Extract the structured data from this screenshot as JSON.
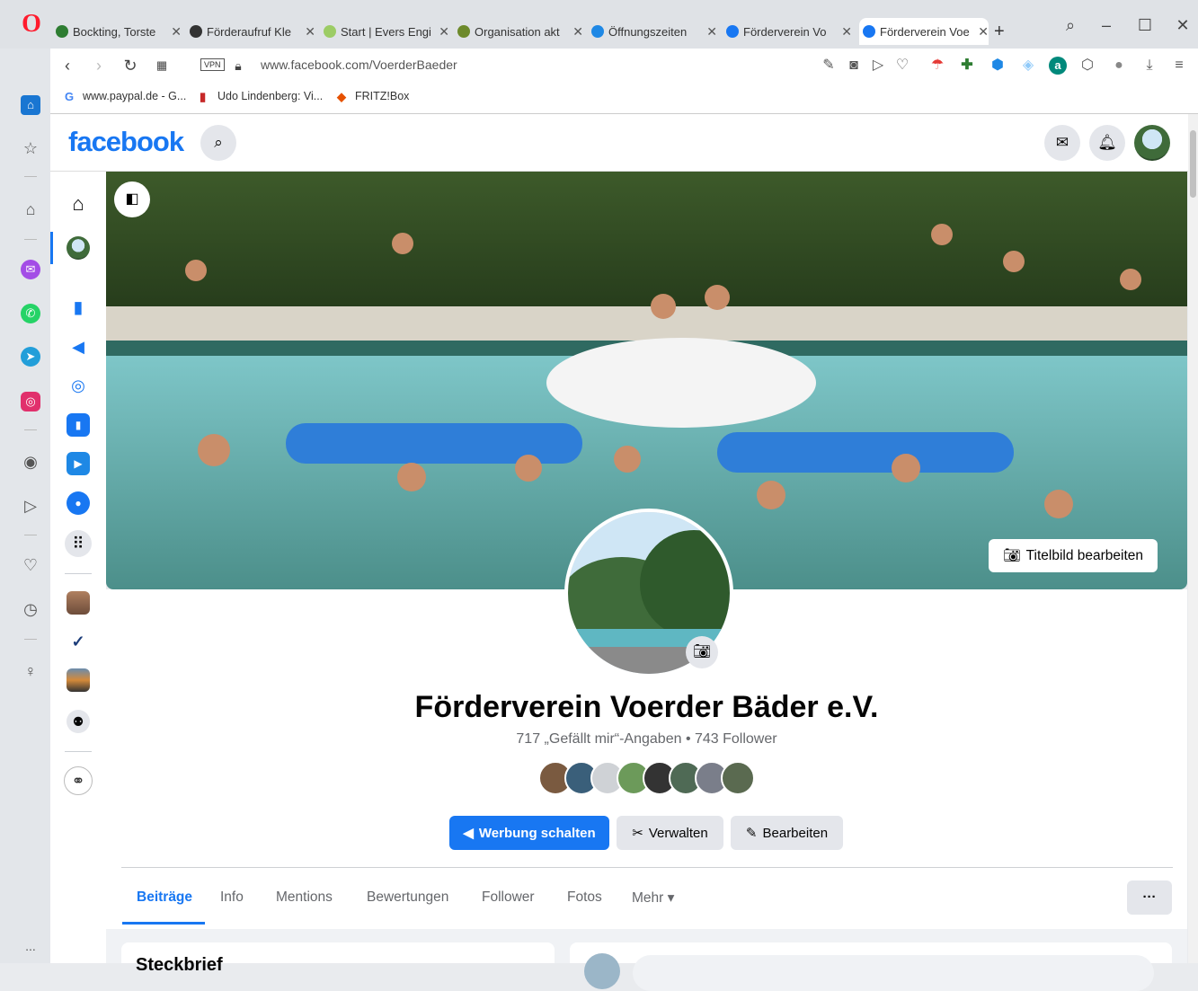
{
  "browser": {
    "tabs": [
      {
        "title": "Bockting, Torste",
        "favicon_color": "#2e7d32"
      },
      {
        "title": "Förderaufruf Kle",
        "favicon_color": "#333333"
      },
      {
        "title": "Start | Evers Engi",
        "favicon_color": "#9ccc65"
      },
      {
        "title": "Organisation akt",
        "favicon_color": "#6d8a2b"
      },
      {
        "title": "Öffnungszeiten",
        "favicon_color": "#1e88e5"
      },
      {
        "title": "Förderverein Vo",
        "favicon_color": "#1877f2"
      },
      {
        "title": "Förderverein Voe",
        "favicon_color": "#1877f2"
      }
    ],
    "new_tab_label": "+",
    "vpn_label": "VPN",
    "url": "www.facebook.com/VoerderBaeder",
    "bookmarks": [
      {
        "label": "www.paypal.de - G...",
        "color": "#4285f4",
        "glyph": "G"
      },
      {
        "label": "Udo Lindenberg: Vi...",
        "color": "#c62828",
        "glyph": "▮"
      },
      {
        "label": "FRITZ!Box",
        "color": "#e65100",
        "glyph": "◆"
      }
    ],
    "sidebar_more": "..."
  },
  "facebook": {
    "logo": "facebook",
    "cover_edit_label": "Titelbild bearbeiten",
    "page_name": "Förderverein Voerder Bäder e.V.",
    "stats": "717 „Gefällt mir“-Angaben • 743 Follower",
    "buttons": {
      "advertise": "Werbung schalten",
      "manage": "Verwalten",
      "edit": "Bearbeiten"
    },
    "tabs": [
      "Beiträge",
      "Info",
      "Mentions",
      "Bewertungen",
      "Follower",
      "Fotos",
      "Mehr"
    ],
    "active_tab_index": 0,
    "more_dots": "···",
    "bottom_left_heading": "Steckbrief"
  },
  "colors": {
    "brand": "#1877f2",
    "opera_red": "#ff1b2d"
  }
}
